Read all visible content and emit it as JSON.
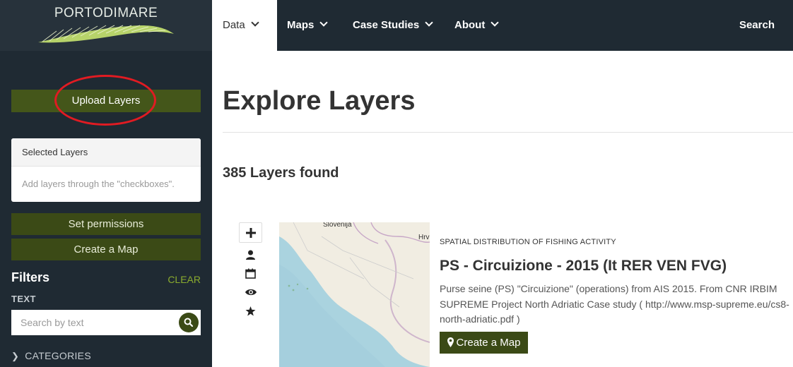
{
  "brand": {
    "name": "PORTODIMARE"
  },
  "sidebar": {
    "upload_label": "Upload Layers",
    "selected_layers": {
      "title": "Selected Layers",
      "hint": "Add layers through the \"checkboxes\"."
    },
    "set_permissions_label": "Set permissions",
    "create_map_label": "Create a Map",
    "filters": {
      "title": "Filters",
      "clear_label": "CLEAR",
      "text_label": "TEXT",
      "search_placeholder": "Search by text",
      "categories_label": "CATEGORIES"
    }
  },
  "nav": {
    "items": [
      {
        "label": "Data",
        "active": true
      },
      {
        "label": "Maps"
      },
      {
        "label": "Case Studies"
      },
      {
        "label": "About"
      }
    ],
    "search_label": "Search"
  },
  "main": {
    "title": "Explore Layers",
    "count_text": "385 Layers found",
    "layer": {
      "category": "SPATIAL DISTRIBUTION OF FISHING ACTIVITY",
      "title": "PS - Circuizione - 2015 (It RER VEN FVG)",
      "description": "Purse seine (PS) \"Circuizione\" (operations) from AIS 2015. From CNR IRBIM SUPREME Project North Adriatic Case study ( http://www.msp-supreme.eu/cs8-north-adriatic.pdf )",
      "create_map_label": "Create a Map",
      "thumb_labels": {
        "slovenia": "Slovenija",
        "croatia": "Hrv"
      }
    }
  },
  "icons": {
    "actions": [
      "plus-icon",
      "user-icon",
      "calendar-icon",
      "eye-icon",
      "star-icon"
    ]
  },
  "colors": {
    "sidebar_bg": "#1f2a33",
    "olive": "#3b4a16",
    "accent_green": "#8aab2e",
    "highlight_red": "#e11b22"
  }
}
